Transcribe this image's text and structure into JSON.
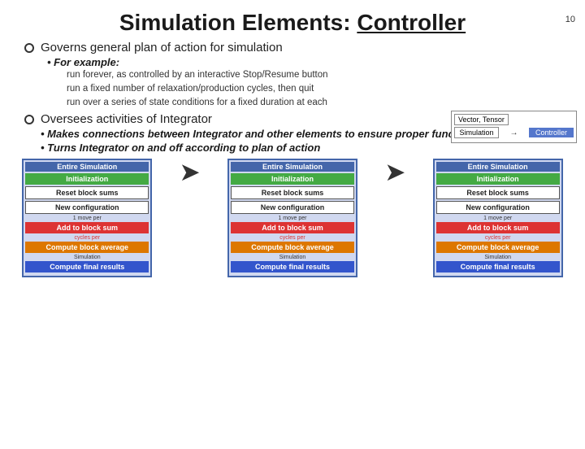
{
  "page": {
    "number": "10",
    "title_start": "Simulation Elements: ",
    "title_underline": "Controller",
    "bullets": [
      {
        "text": "Governs general plan of action for simulation",
        "sub": {
          "label": "For example:",
          "lines": [
            "run forever, as controlled by an interactive Stop/Resume button",
            "run a fixed number of relaxation/production cycles, then quit",
            "run over a series of state conditions for a fixed duration at each"
          ]
        }
      },
      {
        "text": "Oversees activities of Integrator",
        "sub_bullets": [
          "Makes connections between Integrator and other elements to ensure proper functioning",
          "Turns Integrator on and off according to plan of action"
        ]
      }
    ],
    "mini_diagram": {
      "row1": [
        "Vector, Tensor"
      ],
      "row2_label": "Simulation",
      "row3_label": "Controller"
    },
    "diagrams": [
      {
        "title": "Entire Simulation",
        "blocks": [
          {
            "label": "Initialization",
            "style": "green"
          },
          {
            "label": "Reset block sums",
            "style": "white-border"
          },
          {
            "label": "New configuration",
            "style": "white-border"
          },
          {
            "label": "1 move per",
            "style": "small"
          },
          {
            "label": "Add to block sum",
            "style": "red"
          },
          {
            "label": "cycles per",
            "style": "small-red"
          },
          {
            "label": "Compute block average",
            "style": "orange"
          },
          {
            "label": "Simulation",
            "style": "small"
          },
          {
            "label": "Compute final results",
            "style": "blue"
          }
        ]
      },
      {
        "title": "Entire Simulation",
        "blocks": [
          {
            "label": "Initialization",
            "style": "green"
          },
          {
            "label": "Reset block sums",
            "style": "white-border"
          },
          {
            "label": "New configuration",
            "style": "white-border"
          },
          {
            "label": "1 move per",
            "style": "small"
          },
          {
            "label": "Add to block sum",
            "style": "red"
          },
          {
            "label": "cycles per",
            "style": "small-red"
          },
          {
            "label": "Compute block average",
            "style": "orange"
          },
          {
            "label": "Simulation",
            "style": "small"
          },
          {
            "label": "Compute final results",
            "style": "blue"
          }
        ]
      },
      {
        "title": "Entire Simulation",
        "blocks": [
          {
            "label": "Initialization",
            "style": "green"
          },
          {
            "label": "Reset block sums",
            "style": "white-border"
          },
          {
            "label": "New configuration",
            "style": "white-border"
          },
          {
            "label": "1 move per",
            "style": "small"
          },
          {
            "label": "Add to block sum",
            "style": "red"
          },
          {
            "label": "cycles per",
            "style": "small-red"
          },
          {
            "label": "Compute block average",
            "style": "orange"
          },
          {
            "label": "Simulation",
            "style": "small"
          },
          {
            "label": "Compute final results",
            "style": "blue"
          }
        ]
      }
    ]
  }
}
